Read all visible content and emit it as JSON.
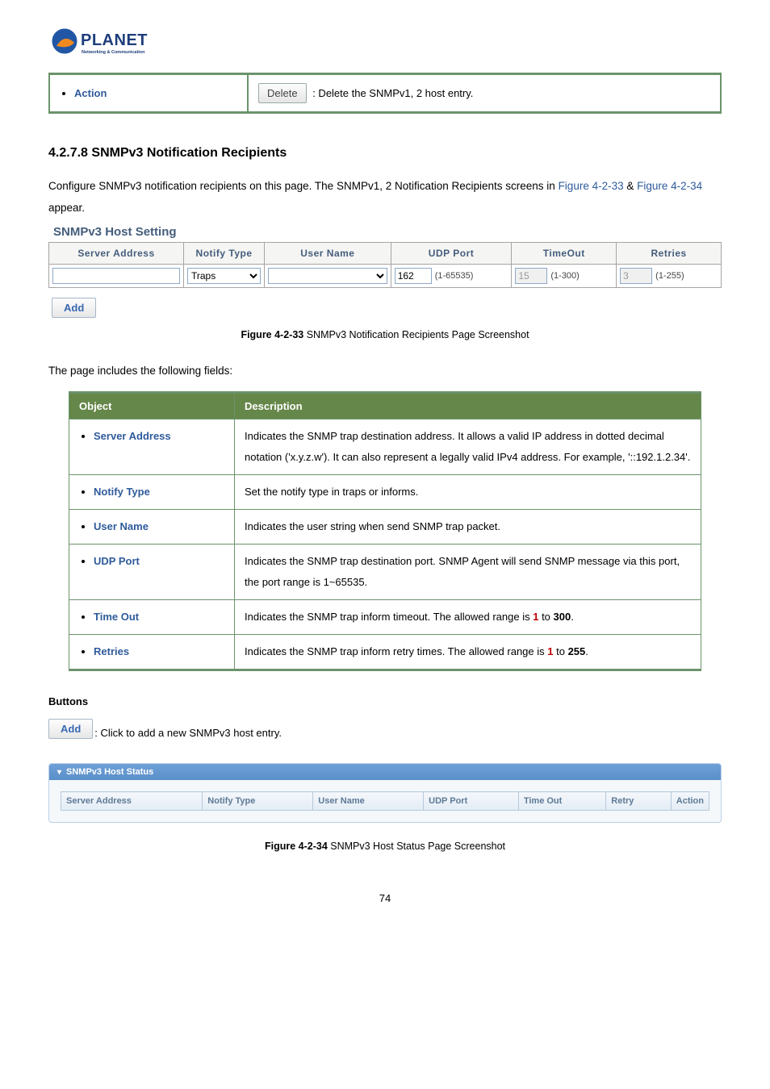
{
  "logo": {
    "brand": "PLANET",
    "tagline": "Networking & Communication"
  },
  "topRow": {
    "label": "Action",
    "button": "Delete",
    "desc": ": Delete the SNMPv1, 2 host entry."
  },
  "section": {
    "number": "4.2.7.8",
    "title": "SNMPv3 Notification Recipients",
    "intro1": "Configure SNMPv3 notification recipients on this page. The SNMPv1, 2 Notification Recipients screens in ",
    "figA": "Figure 4-2-33",
    "introAmp": " & ",
    "figB": "Figure 4-2-34",
    "intro2": " appear."
  },
  "hostSetting": {
    "title": "SNMPv3 Host Setting",
    "headers": [
      "Server Address",
      "Notify Type",
      "User Name",
      "UDP Port",
      "TimeOut",
      "Retries"
    ],
    "row": {
      "serverAddress": "",
      "notifyType": "Traps",
      "userName": "",
      "udpPort": "162",
      "udpRange": "(1-65535)",
      "timeout": "15",
      "timeoutRange": "(1-300)",
      "retries": "3",
      "retriesRange": "(1-255)"
    },
    "addBtn": "Add"
  },
  "caption1": {
    "bold": "Figure 4-2-33",
    "rest": " SNMPv3 Notification Recipients Page Screenshot"
  },
  "fieldsIntro": "The page includes the following fields:",
  "objTable": {
    "headers": [
      "Object",
      "Description"
    ],
    "rows": [
      {
        "obj": "Server Address",
        "desc": "Indicates the SNMP trap destination address. It allows a valid IP address in dotted decimal notation ('x.y.z.w'). It can also represent a legally valid IPv4 address. For example, '::192.1.2.34'."
      },
      {
        "obj": "Notify Type",
        "desc": "Set the notify type in traps or informs."
      },
      {
        "obj": "User Name",
        "desc": "Indicates the user string when send SNMP trap packet."
      },
      {
        "obj": "UDP Port",
        "desc": "Indicates the SNMP trap destination port. SNMP Agent will send SNMP message via this port, the port range is 1~65535."
      },
      {
        "obj": "Time Out",
        "descPre": "Indicates the SNMP trap inform timeout. The allowed range is ",
        "n1": "1",
        "mid": " to ",
        "n2": "300",
        "post": "."
      },
      {
        "obj": "Retries",
        "descPre": "Indicates the SNMP trap inform retry times. The allowed range is ",
        "n1": "1",
        "mid": " to ",
        "n2": "255",
        "post": "."
      }
    ]
  },
  "buttons": {
    "title": "Buttons",
    "addBtn": "Add",
    "addDesc": ": Click to add a new SNMPv3 host entry."
  },
  "statusPanel": {
    "title": "SNMPv3 Host Status",
    "headers": [
      "Server Address",
      "Notify Type",
      "User Name",
      "UDP Port",
      "Time Out",
      "Retry",
      "Action"
    ]
  },
  "caption2": {
    "bold": "Figure 4-2-34",
    "rest": " SNMPv3 Host Status Page Screenshot"
  },
  "pageNumber": "74"
}
